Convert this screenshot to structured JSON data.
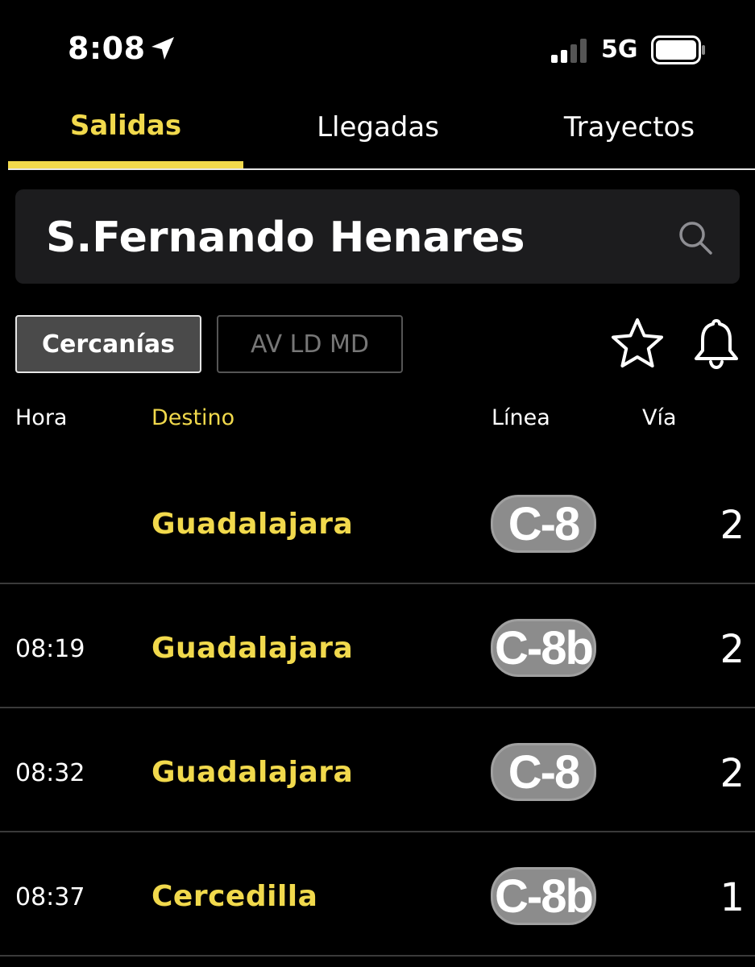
{
  "status": {
    "time": "8:08",
    "network": "5G"
  },
  "tabs": [
    {
      "label": "Salidas",
      "active": true
    },
    {
      "label": "Llegadas",
      "active": false
    },
    {
      "label": "Trayectos",
      "active": false
    }
  ],
  "search": {
    "station": "S.Fernando Henares"
  },
  "filters": {
    "cercanias": "Cercanías",
    "av": "AV LD MD"
  },
  "columns": {
    "hora": "Hora",
    "destino": "Destino",
    "linea": "Línea",
    "via": "Vía"
  },
  "rows": [
    {
      "hora": "",
      "destino": "Guadalajara",
      "linea": "C-8",
      "via": "2"
    },
    {
      "hora": "08:19",
      "destino": "Guadalajara",
      "linea": "C-8b",
      "via": "2"
    },
    {
      "hora": "08:32",
      "destino": "Guadalajara",
      "linea": "C-8",
      "via": "2"
    },
    {
      "hora": "08:37",
      "destino": "Cercedilla",
      "linea": "C-8b",
      "via": "1"
    }
  ],
  "colors": {
    "accent": "#f1d94c",
    "background": "#000000",
    "badge": "#8c8c8c"
  },
  "icons": [
    "location-arrow-icon",
    "signal-icon",
    "battery-icon",
    "search-icon",
    "star-icon",
    "bell-icon"
  ]
}
